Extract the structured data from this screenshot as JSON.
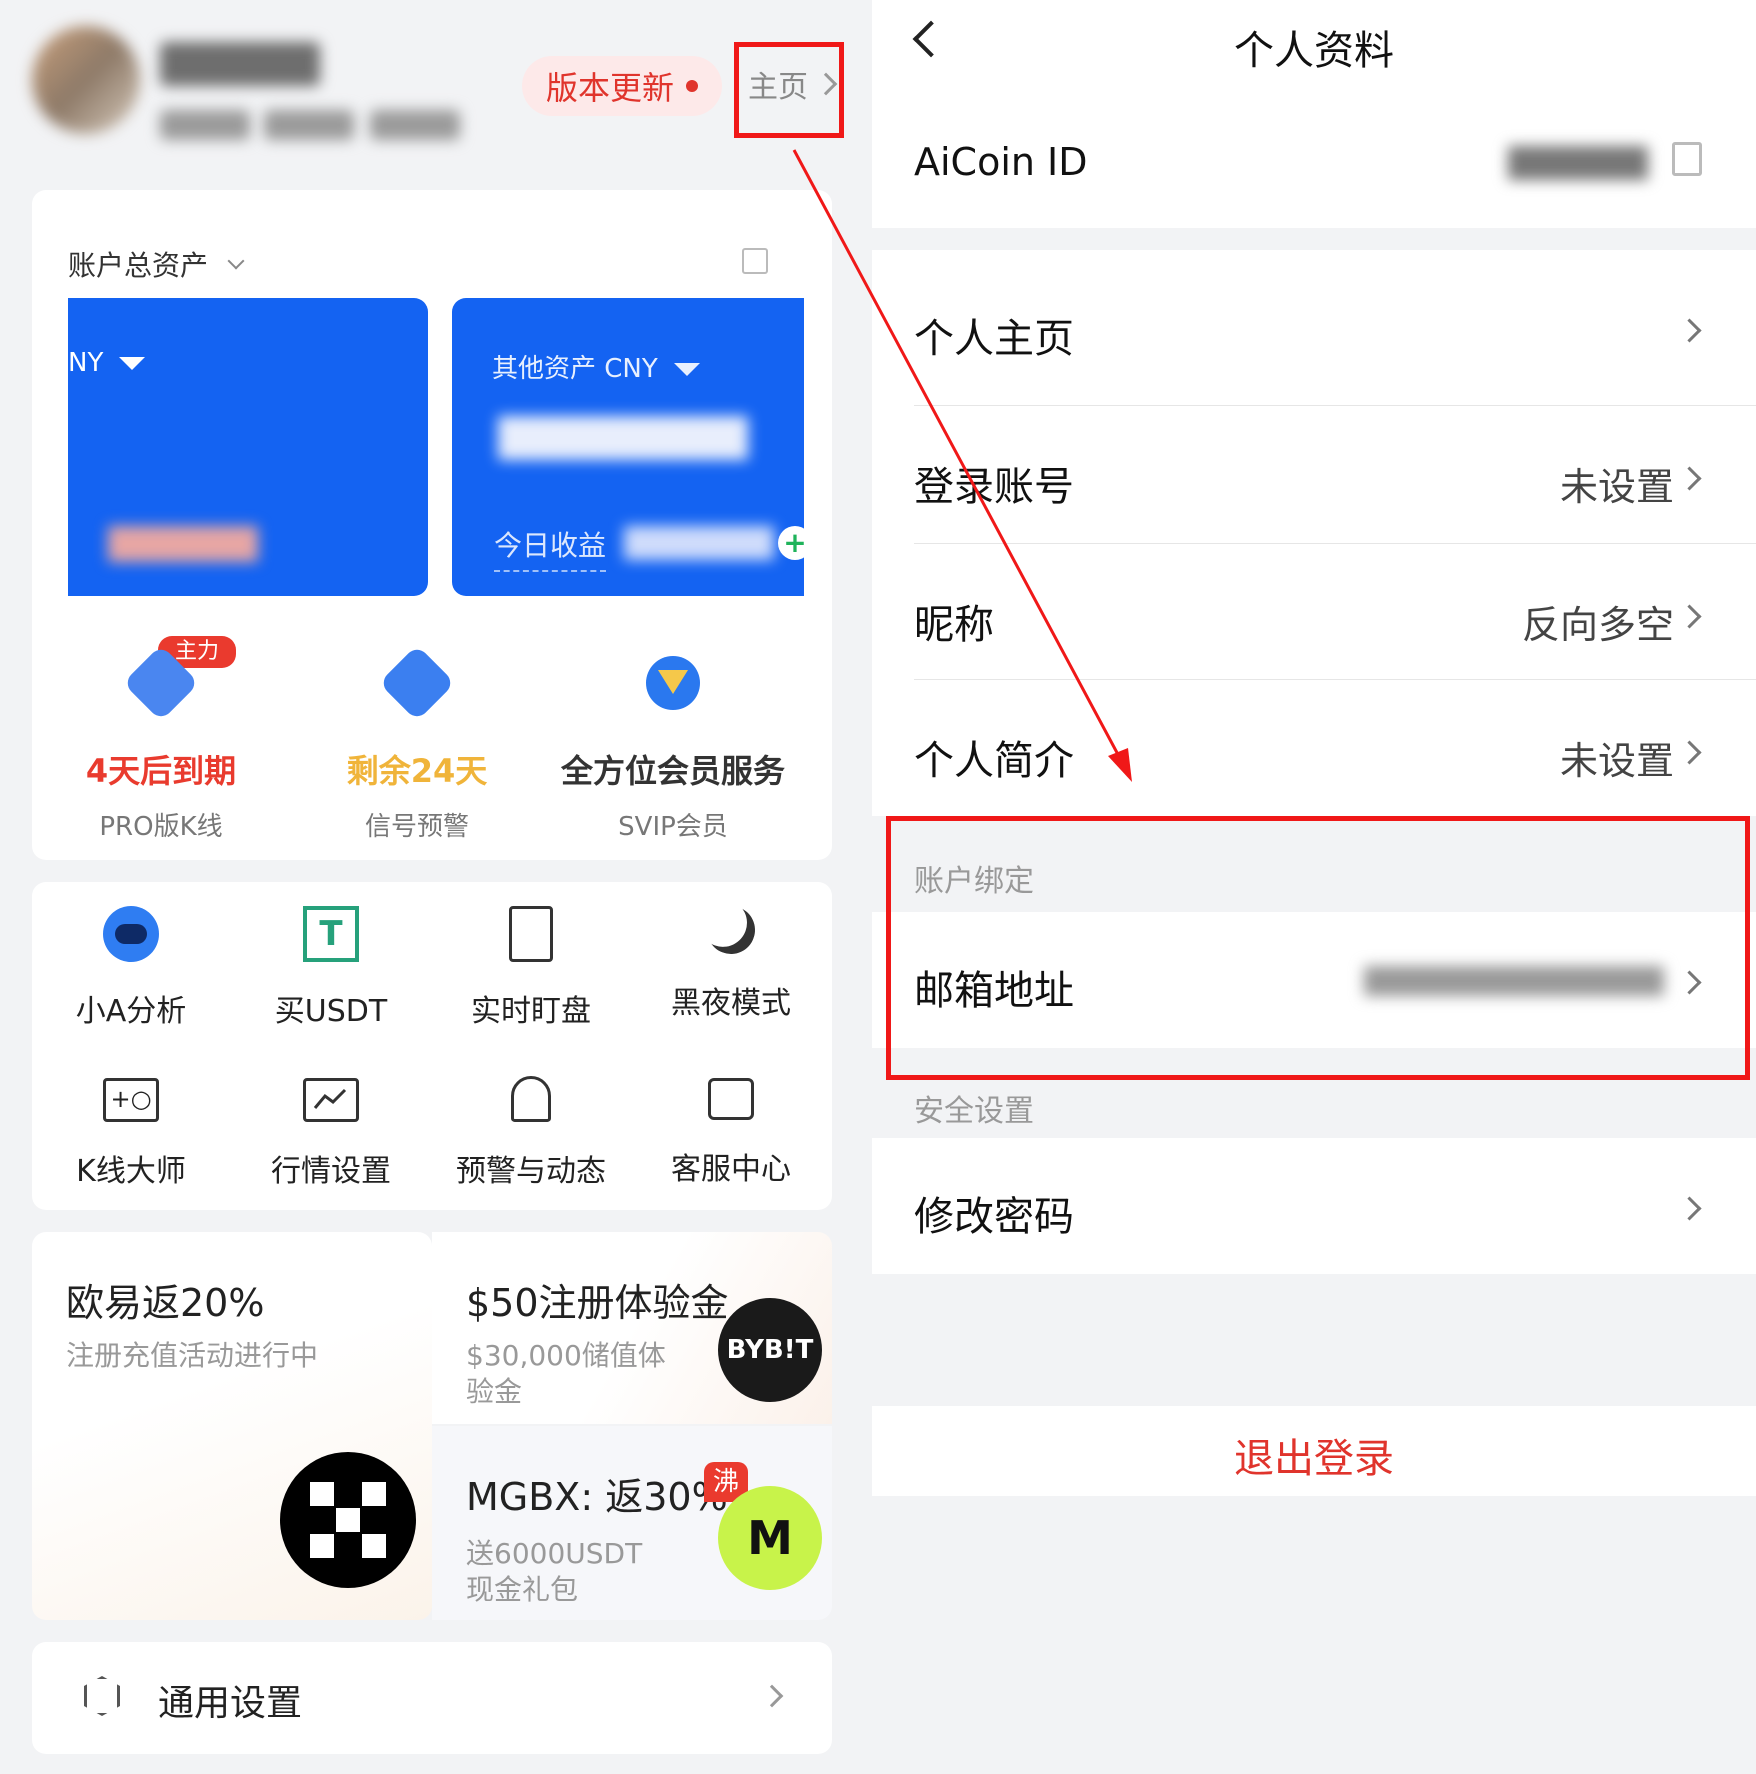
{
  "left": {
    "header": {
      "update_label": "版本更新",
      "home_link": "主页"
    },
    "assets": {
      "title": "账户总资产",
      "card1_currency": "NY",
      "card2_currency": "其他资产  CNY",
      "card2_today_label": "今日收益"
    },
    "vip": [
      {
        "main": "4天后到期",
        "sub": "PRO版K线",
        "color": "#e93b2e",
        "tag": "主力"
      },
      {
        "main": "剩余24天",
        "sub": "信号预警",
        "color": "#f0b43a"
      },
      {
        "main": "全方位会员服务",
        "sub": "SVIP会员",
        "color": "#333333"
      }
    ],
    "tools": [
      {
        "label": "小A分析",
        "icon": "robot-icon"
      },
      {
        "label": "买USDT",
        "icon": "usdt-icon"
      },
      {
        "label": "实时盯盘",
        "icon": "document-icon"
      },
      {
        "label": "黑夜模式",
        "icon": "moon-icon"
      },
      {
        "label": "K线大师",
        "icon": "kline-master-icon"
      },
      {
        "label": "行情设置",
        "icon": "chart-settings-icon"
      },
      {
        "label": "预警与动态",
        "icon": "bell-icon"
      },
      {
        "label": "客服中心",
        "icon": "support-icon"
      }
    ],
    "promos": {
      "okx_title": "欧易返20%",
      "okx_sub": "注册充值活动进行中",
      "bybit_title": "$50注册体验金",
      "bybit_sub": "$30,000储值体验金",
      "bybit_logo": "BYB!T",
      "mgbx_title": "MGBX: 返30%",
      "mgbx_badge": "沸",
      "mgbx_sub": "送6000USDT现金礼包"
    },
    "settings": {
      "label": "通用设置"
    }
  },
  "right": {
    "nav": {
      "title": "个人资料"
    },
    "aicoin_id_label": "AiCoin ID",
    "rows": [
      {
        "label": "个人主页",
        "value": ""
      },
      {
        "label": "登录账号",
        "value": "未设置"
      },
      {
        "label": "昵称",
        "value": "反向多空"
      },
      {
        "label": "个人简介",
        "value": "未设置"
      }
    ],
    "binding_section": "账户绑定",
    "email_label": "邮箱地址",
    "security_section": "安全设置",
    "password_label": "修改密码",
    "logout_label": "退出登录"
  },
  "colors": {
    "accent_blue": "#1463f2",
    "annotation_red": "#f01818",
    "danger_red": "#e0342c"
  }
}
